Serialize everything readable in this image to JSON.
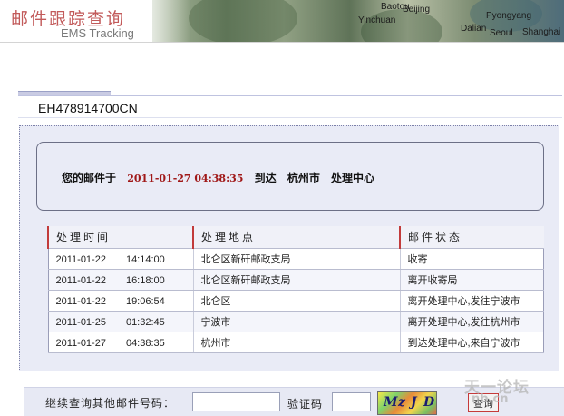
{
  "header": {
    "title_cn": "邮件跟踪查询",
    "title_en": "EMS Tracking",
    "map_labels": [
      "Baotou",
      "Beijing",
      "Pyongyang",
      "Seoul",
      "Yinchuan",
      "Dalian",
      "Shanghai"
    ]
  },
  "tracking": {
    "number": "EH478914700CN"
  },
  "status": {
    "prefix": "您的邮件于",
    "datetime": "2011-01-27 04:38:35",
    "arrive": "到达",
    "city": "杭州市",
    "suffix": "处理中心",
    "date_color": "#a01818"
  },
  "table": {
    "headers": [
      "处理时间",
      "处理地点",
      "邮件状态"
    ],
    "rows": [
      {
        "time": "2011-01-22　　14:14:00",
        "place": "北仑区新矸邮政支局",
        "state": "收寄"
      },
      {
        "time": "2011-01-22　　16:18:00",
        "place": "北仑区新矸邮政支局",
        "state": "离开收寄局"
      },
      {
        "time": "2011-01-22　　19:06:54",
        "place": "北仑区",
        "state": "离开处理中心,发往宁波市"
      },
      {
        "time": "2011-01-25　　01:32:45",
        "place": "宁波市",
        "state": "离开处理中心,发往杭州市"
      },
      {
        "time": "2011-01-27　　04:38:35",
        "place": "杭州市",
        "state": "到达处理中心,来自宁波市"
      }
    ]
  },
  "query": {
    "label": "继续查询其他邮件号码：",
    "input_value": "",
    "captcha_label": "验证码",
    "captcha_value": "",
    "captcha_image_text": [
      "M",
      "z",
      "J",
      "D"
    ],
    "button_label": "查询"
  },
  "watermark": {
    "line1": "天一论坛",
    "line2": "nb.cn"
  },
  "colors": {
    "accent_red": "#c23b3b",
    "panel_bg": "#e9ebf6",
    "title_red": "#c25a5a"
  }
}
